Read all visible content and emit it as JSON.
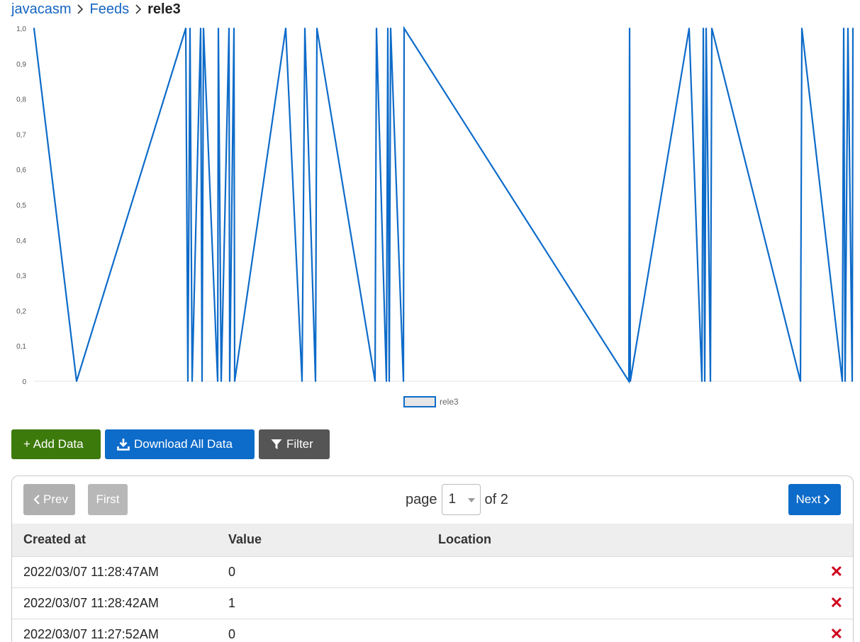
{
  "breadcrumb": {
    "user": "javacasm",
    "section": "Feeds",
    "feed": "rele3"
  },
  "chart_data": {
    "type": "line",
    "series": [
      {
        "name": "rele3",
        "values": [
          1,
          0,
          1,
          0,
          1,
          0,
          1,
          0,
          1,
          0,
          1,
          0,
          1,
          0,
          1,
          0,
          1,
          0,
          1,
          0,
          1,
          0,
          1,
          0,
          1,
          0,
          1,
          0,
          1,
          0,
          1,
          0,
          1,
          0,
          1,
          0,
          1,
          0,
          1,
          0,
          1,
          0,
          1,
          0,
          1,
          0,
          1
        ]
      }
    ],
    "yticks": [
      "0",
      "0,1",
      "0,2",
      "0,3",
      "0,4",
      "0,5",
      "0,6",
      "0,7",
      "0,8",
      "0,9",
      "1,0"
    ],
    "ylim": [
      0,
      1
    ],
    "legend_position": "bottom-center",
    "line_color": "#0d6bc9"
  },
  "actions": {
    "add_label": "+ Add Data",
    "download_label": "Download All Data",
    "filter_label": "Filter"
  },
  "pagination": {
    "prev_label": "Prev",
    "first_label": "First",
    "page_word": "page",
    "current_page": "1",
    "of_text": "of 2",
    "next_label": "Next"
  },
  "table": {
    "headers": [
      "Created at",
      "Value",
      "Location"
    ],
    "rows": [
      {
        "created": "2022/03/07 11:28:47AM",
        "value": "0",
        "location": ""
      },
      {
        "created": "2022/03/07 11:28:42AM",
        "value": "1",
        "location": ""
      },
      {
        "created": "2022/03/07 11:27:52AM",
        "value": "0",
        "location": ""
      }
    ],
    "delete_symbol": "✕"
  }
}
